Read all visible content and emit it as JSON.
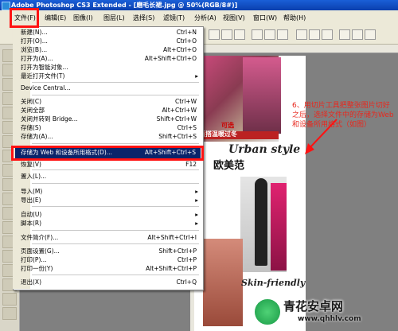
{
  "window": {
    "title": "Adobe Photoshop CS3 Extended - [磨毛长裙.jpg @ 50%(RGB/8#)]"
  },
  "menubar": {
    "items": [
      "文件(F)",
      "编辑(E)",
      "图像(I)",
      "图层(L)",
      "选择(S)",
      "滤镜(T)",
      "分析(A)",
      "视图(V)",
      "窗口(W)",
      "帮助(H)"
    ]
  },
  "file_menu": {
    "items": [
      {
        "label": "新建(N)...",
        "shortcut": "Ctrl+N"
      },
      {
        "label": "打开(O)...",
        "shortcut": "Ctrl+O"
      },
      {
        "label": "浏览(B)...",
        "shortcut": "Alt+Ctrl+O"
      },
      {
        "label": "打开为(A)...",
        "shortcut": "Alt+Shift+Ctrl+O"
      },
      {
        "label": "打开为智能对象...",
        "shortcut": ""
      },
      {
        "label": "最近打开文件(T)",
        "shortcut": "",
        "submenu": true
      },
      {
        "label": "Device Central...",
        "shortcut": ""
      },
      {
        "label": "关闭(C)",
        "shortcut": "Ctrl+W"
      },
      {
        "label": "关闭全部",
        "shortcut": "Alt+Ctrl+W"
      },
      {
        "label": "关闭并转到 Bridge...",
        "shortcut": "Shift+Ctrl+W"
      },
      {
        "label": "存储(S)",
        "shortcut": "Ctrl+S"
      },
      {
        "label": "存储为(A)...",
        "shortcut": "Shift+Ctrl+S"
      },
      {
        "label": "存储为 Web 和设备所用格式(D)...",
        "shortcut": "Alt+Shift+Ctrl+S"
      },
      {
        "label": "恢复(V)",
        "shortcut": "F12"
      },
      {
        "label": "置入(L)...",
        "shortcut": ""
      },
      {
        "label": "导入(M)",
        "shortcut": "",
        "submenu": true
      },
      {
        "label": "导出(E)",
        "shortcut": "",
        "submenu": true
      },
      {
        "label": "自动(U)",
        "shortcut": "",
        "submenu": true
      },
      {
        "label": "脚本(R)",
        "shortcut": "",
        "submenu": true
      },
      {
        "label": "文件简介(F)...",
        "shortcut": "Alt+Shift+Ctrl+I"
      },
      {
        "label": "页面设置(G)...",
        "shortcut": "Shift+Ctrl+P"
      },
      {
        "label": "打印(P)...",
        "shortcut": "Ctrl+P"
      },
      {
        "label": "打印一份(Y)",
        "shortcut": "Alt+Shift+Ctrl+P"
      },
      {
        "label": "退出(X)",
        "shortcut": "Ctrl+Q"
      }
    ]
  },
  "canvas": {
    "strip_text": "百搭温暖过冬",
    "strip_text2": "可选",
    "style_text": "Urban style",
    "ou_text": "欧美范",
    "skin_text": "Skin-friendly"
  },
  "annotation": {
    "text": "6、用切片工具把整张图片切好之后，选择文件中的存储为Web和设备所用格式（如图）"
  },
  "watermark": {
    "name": "青花安卓网",
    "url": "www.qhhlv.com"
  },
  "colors": {
    "highlight_box": "#ff1212",
    "selected_item_bg": "#0a246a",
    "annotation_text": "#e8281e"
  }
}
